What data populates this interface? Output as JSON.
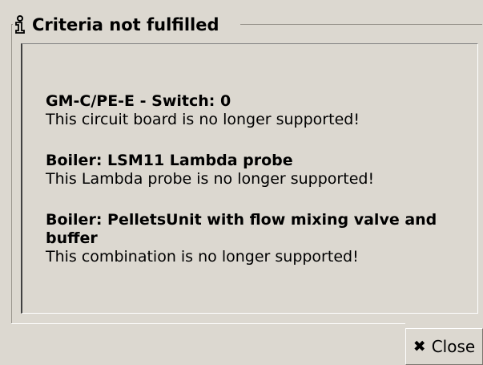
{
  "dialog": {
    "title": "Criteria not fulfilled",
    "title_icon": "info-icon",
    "messages": [
      {
        "heading": "GM-C/PE-E  -  Switch: 0",
        "text": "This circuit board is no longer supported!"
      },
      {
        "heading": "Boiler: LSM11 Lambda probe",
        "text": "This Lambda probe is no longer supported!"
      },
      {
        "heading": "Boiler: PelletsUnit with flow mixing valve and buffer",
        "text": "This combination is no longer supported!"
      }
    ],
    "close_button": {
      "label": "Close",
      "icon": "close-icon"
    }
  },
  "colors": {
    "background": "#dcd8d0",
    "text": "#000000"
  }
}
